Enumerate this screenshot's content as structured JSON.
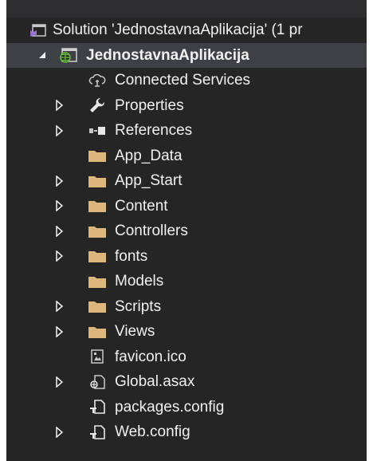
{
  "solution": {
    "label": "Solution 'JednostavnaAplikacija' (1 pr"
  },
  "project": {
    "label": "JednostavnaAplikacija"
  },
  "items": [
    {
      "label": "Connected Services",
      "icon": "connected-services-icon",
      "expandable": false
    },
    {
      "label": "Properties",
      "icon": "wrench-icon",
      "expandable": true
    },
    {
      "label": "References",
      "icon": "references-icon",
      "expandable": true
    },
    {
      "label": "App_Data",
      "icon": "folder-icon",
      "expandable": false
    },
    {
      "label": "App_Start",
      "icon": "folder-icon",
      "expandable": true
    },
    {
      "label": "Content",
      "icon": "folder-icon",
      "expandable": true
    },
    {
      "label": "Controllers",
      "icon": "folder-icon",
      "expandable": true
    },
    {
      "label": "fonts",
      "icon": "folder-icon",
      "expandable": true
    },
    {
      "label": "Models",
      "icon": "folder-icon",
      "expandable": false
    },
    {
      "label": "Scripts",
      "icon": "folder-icon",
      "expandable": true
    },
    {
      "label": "Views",
      "icon": "folder-icon",
      "expandable": true
    },
    {
      "label": "favicon.ico",
      "icon": "image-file-icon",
      "expandable": false
    },
    {
      "label": "Global.asax",
      "icon": "global-asax-icon",
      "expandable": true
    },
    {
      "label": "packages.config",
      "icon": "config-file-icon",
      "expandable": false
    },
    {
      "label": "Web.config",
      "icon": "config-file-icon",
      "expandable": true
    }
  ],
  "colors": {
    "panel_bg": "#252526",
    "text": "#f1f1f1",
    "folder": "#dcb67a",
    "selected_row": "#3f3f46"
  }
}
